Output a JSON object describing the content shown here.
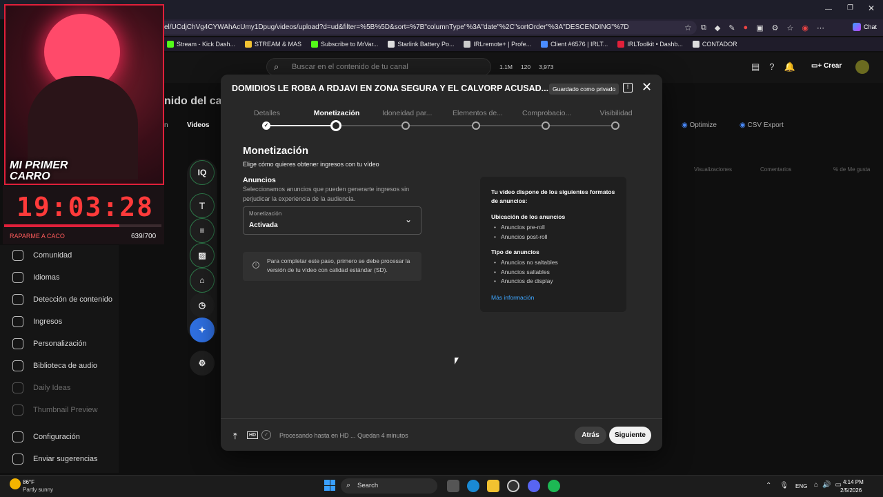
{
  "browser": {
    "url": "el/UCdjChVg4CYWAhAcUmy1Dpug/videos/upload?d=ud&filter=%5B%5D&sort=%7B\"columnType\"%3A\"date\"%2C\"sortOrder\"%3A\"DESCENDING\"%7D",
    "bookmarks": [
      {
        "label": "Stream - Kick Dash...",
        "color": "#53fc18"
      },
      {
        "label": "STREAM & MAS",
        "color": "#f1c232"
      },
      {
        "label": "Subscribe to MrVar...",
        "color": "#53fc18"
      },
      {
        "label": "Starlink Battery Po...",
        "color": "#dddddd"
      },
      {
        "label": "IRLremote+ | Profe...",
        "color": "#cccccc"
      },
      {
        "label": "Client #6576 | IRLT...",
        "color": "#4a8cff"
      },
      {
        "label": "IRLToolkit • Dashb...",
        "color": "#e0203a"
      },
      {
        "label": "CONTADOR",
        "color": "#dddddd"
      }
    ],
    "profile_label": "Chat"
  },
  "studio": {
    "search_placeholder": "Buscar en el contenido de tu canal",
    "stats": [
      "1.1M",
      "120",
      "3,973"
    ],
    "create_label": "Crear",
    "page_title_partial": "nido del can",
    "tab_partial": "n",
    "tab_videos": "Videos",
    "optimize_label": "Optimize",
    "csv_label": "CSV Export",
    "col_views": "Visualizaciones",
    "col_comments": "Comentarios",
    "col_likes": "% de Me gusta",
    "sidebar": [
      {
        "label": "Comunidad",
        "dim": false
      },
      {
        "label": "Idiomas",
        "dim": false
      },
      {
        "label": "Detección de contenido",
        "dim": false
      },
      {
        "label": "Ingresos",
        "dim": false
      },
      {
        "label": "Personalización",
        "dim": false
      },
      {
        "label": "Biblioteca de audio",
        "dim": false
      },
      {
        "label": "Daily Ideas",
        "dim": true
      },
      {
        "label": "Thumbnail Preview",
        "dim": true
      },
      {
        "label": "Configuración",
        "dim": false
      },
      {
        "label": "Enviar sugerencias",
        "dim": false
      }
    ]
  },
  "overlay": {
    "badge": "MI PRIMER CARRO",
    "timer": "19:03:28",
    "progress_label": "RAPARME A CACO",
    "progress_count": "639/700",
    "progress_fraction": 0.913
  },
  "modal": {
    "title": "DOMIDIOS LE ROBA A RDJAVI EN ZONA SEGURA Y EL CALVORP ACUSAD...",
    "saved_badge": "Guardado como privado",
    "steps": [
      {
        "label": "Detalles",
        "state": "done"
      },
      {
        "label": "Monetización",
        "state": "active"
      },
      {
        "label": "Idoneidad par...",
        "state": "todo"
      },
      {
        "label": "Elementos de...",
        "state": "todo"
      },
      {
        "label": "Comprobacio...",
        "state": "todo"
      },
      {
        "label": "Visibilidad",
        "state": "todo"
      }
    ],
    "heading": "Monetización",
    "subheading": "Elige cómo quieres obtener ingresos con tu vídeo",
    "ads_title": "Anuncios",
    "ads_desc": "Seleccionamos anuncios que pueden generarte ingresos sin perjudicar la experiencia de la audiencia.",
    "select_label": "Monetización",
    "select_value": "Activada",
    "info_text": "Para completar este paso, primero se debe procesar la versión de tu vídeo con calidad estándar (SD).",
    "panel": {
      "intro": "Tu vídeo dispone de los siguientes formatos de anuncios:",
      "placement_title": "Ubicación de los anuncios",
      "placement_items": [
        "Anuncios pre-roll",
        "Anuncios post-roll"
      ],
      "types_title": "Tipo de anuncios",
      "types_items": [
        "Anuncios no saltables",
        "Anuncios saltables",
        "Anuncios de display"
      ],
      "more": "Más información"
    },
    "footer_status": "Procesando hasta en HD ... Quedan 4 minutos",
    "hd_label": "HD",
    "back_label": "Atrás",
    "next_label": "Siguiente"
  },
  "rail": {
    "iq_label": "IQ",
    "text_label": "T"
  },
  "taskbar": {
    "temp": "86°F",
    "weather": "Partly sunny",
    "search": "Search",
    "lang": "ENG",
    "time": "4:14 PM",
    "date": "2/5/2026"
  }
}
